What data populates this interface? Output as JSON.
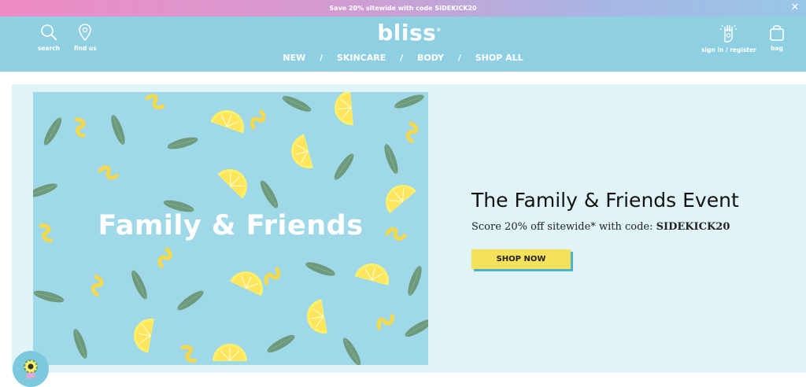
{
  "promo": {
    "text": "Save 20% sitewide with code SIDEKICK20"
  },
  "header": {
    "logo": "bliss",
    "left_icons": [
      {
        "label": "search",
        "icon": "search-icon"
      },
      {
        "label": "find us",
        "icon": "location-pin-icon"
      }
    ],
    "right_icons": [
      {
        "label": "sign in / register",
        "icon": "hand-icon"
      },
      {
        "label": "bag",
        "icon": "shopping-bag-icon"
      }
    ],
    "nav": [
      "NEW",
      "SKINCARE",
      "BODY",
      "SHOP ALL"
    ],
    "nav_separator": "/"
  },
  "hero": {
    "image_text": "Family & Friends",
    "title": "The Family & Friends Event",
    "subtitle_prefix": "Score 20% off sitewide* with code: ",
    "subtitle_code": "SIDEKICK20",
    "button": "SHOP NOW"
  },
  "colors": {
    "header": "#8ecfe2",
    "hero_bg": "#e0f4f8",
    "button": "#f5e15a",
    "button_shadow": "#4bb2cf"
  }
}
